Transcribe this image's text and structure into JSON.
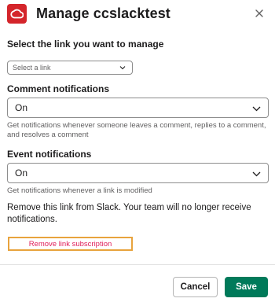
{
  "dialog": {
    "title": "Manage ccslacktest",
    "app_icon": "adobe-creative-cloud-icon",
    "close_icon": "close-icon",
    "brand_color": "#d4252b"
  },
  "link_select": {
    "label": "Select the link you want to manage",
    "value": "Select a link"
  },
  "comment_notifications": {
    "label": "Comment notifications",
    "value": "On",
    "help": "Get notifications whenever someone leaves a comment, replies to a comment, and resolves a comment"
  },
  "event_notifications": {
    "label": "Event notifications",
    "value": "On",
    "help": "Get notifications whenever a link is modified"
  },
  "remove": {
    "description": "Remove this link from Slack. Your team will no longer receive notifications.",
    "link_label": "Remove link subscription",
    "link_color": "#e01e5a",
    "highlight_color": "#e8a33d"
  },
  "footer": {
    "cancel_label": "Cancel",
    "save_label": "Save",
    "save_color": "#007a5a"
  }
}
